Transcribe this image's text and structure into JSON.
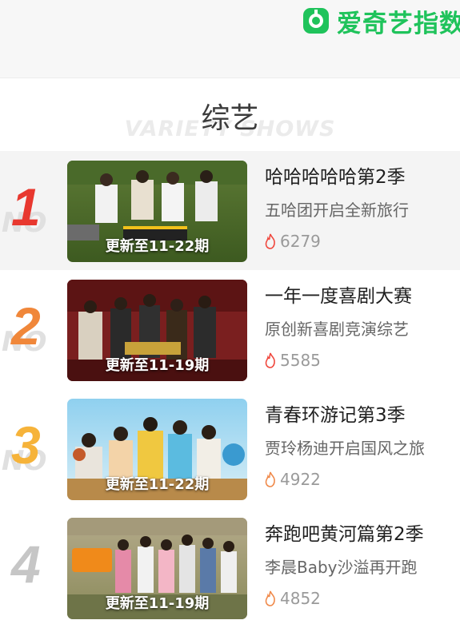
{
  "brand": {
    "name": "爱奇艺指数",
    "color": "#1fc35b"
  },
  "section": {
    "title": "综艺",
    "bg_text": "VARIETY SHOWS"
  },
  "rank_prefix": "NO",
  "colors": {
    "rank1": "#e8382f",
    "rank2": "#f0873a",
    "rank3": "#f6b33a",
    "rank_other": "#c6c6c6",
    "flame_hot": "#f0483e",
    "flame_warm": "#f08a4b"
  },
  "items": [
    {
      "rank": "1",
      "name": "哈哈哈哈哈第2季",
      "desc": "五哈团开启全新旅行",
      "update": "更新至11-22期",
      "heat": "6279"
    },
    {
      "rank": "2",
      "name": "一年一度喜剧大赛",
      "desc": "原创新喜剧竞演综艺",
      "update": "更新至11-19期",
      "heat": "5585"
    },
    {
      "rank": "3",
      "name": "青春环游记第3季",
      "desc": "贾玲杨迪开启国风之旅",
      "update": "更新至11-22期",
      "heat": "4922"
    },
    {
      "rank": "4",
      "name": "奔跑吧黄河篇第2季",
      "desc": "李晨Baby沙溢再开跑",
      "update": "更新至11-19期",
      "heat": "4852"
    }
  ]
}
